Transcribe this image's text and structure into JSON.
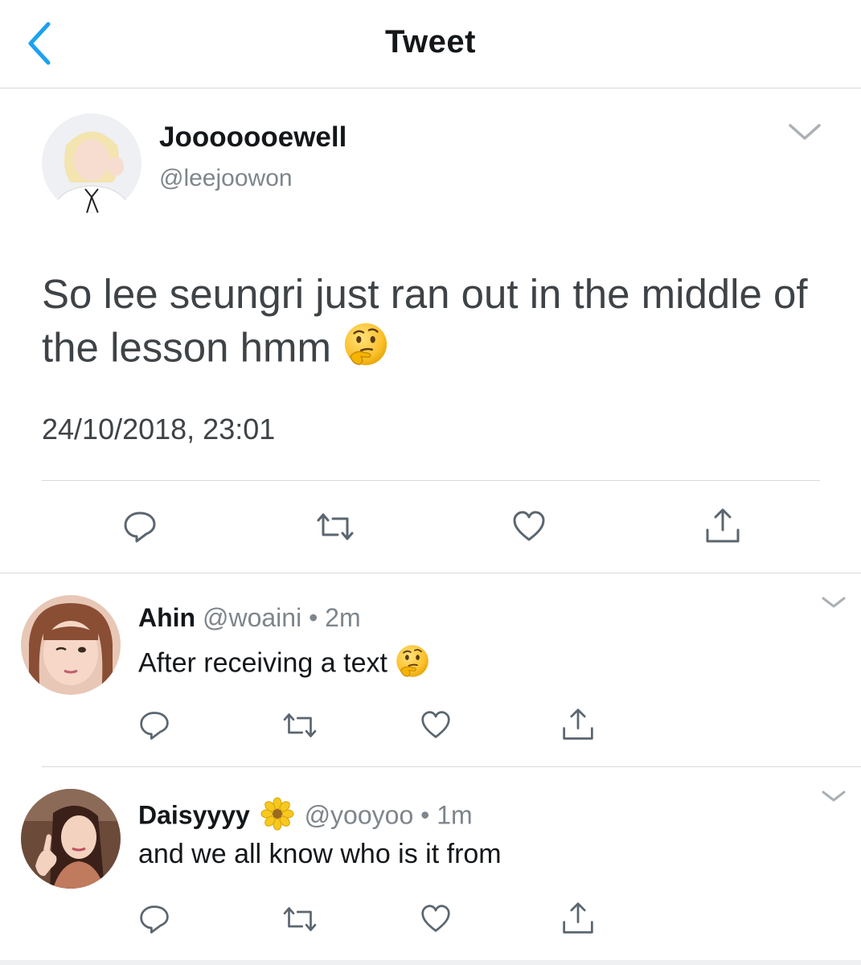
{
  "header": {
    "title": "Tweet",
    "back_icon": "chevron-left-icon"
  },
  "colors": {
    "accent": "#1da1f2",
    "text": "#14171a",
    "secondary": "#7e858c",
    "divider": "#d6d9dc"
  },
  "main_tweet": {
    "display_name": "Jooooooewell",
    "handle": "@leejoowon",
    "text": "So lee seungri just ran out in the middle of the lesson hmm",
    "emoji": "thinking-face",
    "timestamp": "24/10/2018, 23:01",
    "actions": [
      "reply-icon",
      "retweet-icon",
      "like-icon",
      "share-icon"
    ]
  },
  "replies": [
    {
      "display_name": "Ahin",
      "handle": "@woaini",
      "separator": "•",
      "time": "2m",
      "text": "After receiving a text",
      "emoji": "thinking-face"
    },
    {
      "display_name": "Daisyyyy",
      "name_emoji": "blossom",
      "handle": "@yooyoo",
      "separator": "•",
      "time": "1m",
      "text": "and we all know who is it from"
    }
  ]
}
